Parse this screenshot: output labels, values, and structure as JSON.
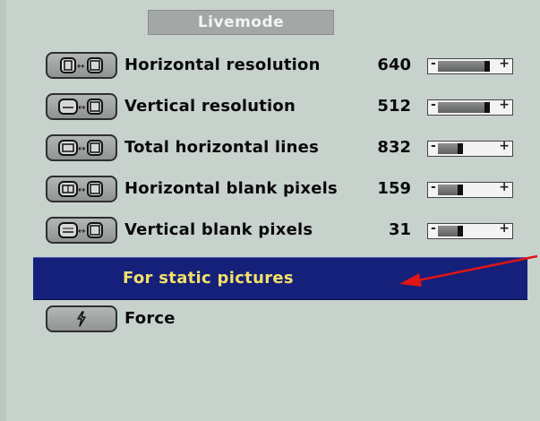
{
  "window": {
    "title": "Livemode"
  },
  "rows": [
    {
      "icon": "horizontal-resolution-icon",
      "label": "Horizontal resolution",
      "value": "640",
      "slider_level": 0.78
    },
    {
      "icon": "vertical-resolution-icon",
      "label": "Vertical resolution",
      "value": "512",
      "slider_level": 0.78
    },
    {
      "icon": "total-horizontal-lines-icon",
      "label": "Total horizontal lines",
      "value": "832",
      "slider_level": 0.35
    },
    {
      "icon": "horizontal-blank-pixels-icon",
      "label": "Horizontal blank pixels",
      "value": "159",
      "slider_level": 0.35
    },
    {
      "icon": "vertical-blank-pixels-icon",
      "label": "Vertical blank pixels",
      "value": "31",
      "slider_level": 0.35
    }
  ],
  "slider_symbols": {
    "minus": "-",
    "plus": "+"
  },
  "selected_option": {
    "label": "For static pictures"
  },
  "force": {
    "icon": "lightning-icon",
    "label": "Force"
  },
  "colors": {
    "background": "#c8d2cd",
    "selected_bar": "#14207a",
    "selected_text": "#f2e06a",
    "arrow": "#e01515"
  }
}
